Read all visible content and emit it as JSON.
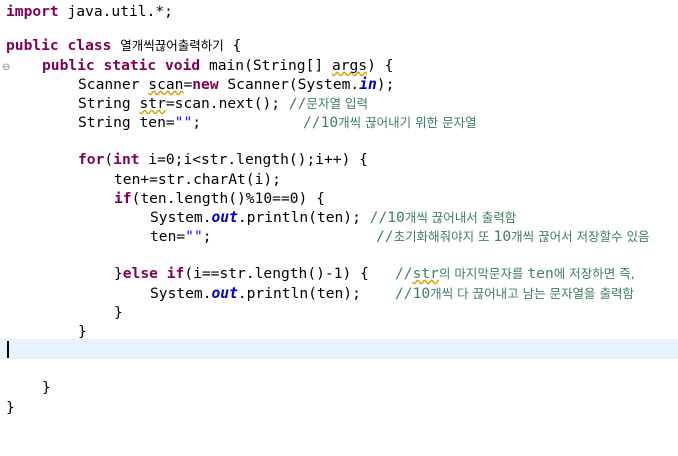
{
  "code": {
    "l1_kw": "import",
    "l1_rest": " java.util.*;",
    "l3_kw": "public class",
    "l3_name": "열개씩끊어출력하기",
    "l3_tail": " {",
    "l4_kw": "public static void",
    "l4_rest": " main(String[] ",
    "l4_args": "args",
    "l4_tail": ") {",
    "l5_a": "Scanner ",
    "l5_var": "scan",
    "l5_eq": "=",
    "l5_new": "new",
    "l5_b": " Scanner(System.",
    "l5_in": "in",
    "l5_c": ");",
    "l6_a": "String ",
    "l6_var": "str",
    "l6_b": "=scan.next(); ",
    "l6_cm_slash": "//",
    "l6_cm": "문자열 입력",
    "l7_a": "String ten=",
    "l7_str": "\"\"",
    "l7_b": ";",
    "l7_cm_slash": "//10",
    "l7_cm": "개씩 끊어내기 위한 문자열",
    "l9_for": "for",
    "l9_a": "(",
    "l9_int": "int",
    "l9_b": " i=0;i<str.length();i++) {",
    "l10": "ten+=str.charAt(i);",
    "l11_if": "if",
    "l11_b": "(ten.length()%10==0) {",
    "l12_a": "System.",
    "l12_out": "out",
    "l12_b": ".println(ten); ",
    "l12_cm_slash": "//10",
    "l12_cm": "개씩 끊어내서 출력함",
    "l13_a": "ten=",
    "l13_str": "\"\"",
    "l13_b": ";",
    "l13_cm_slash": "//",
    "l13_cm1": "초기화해줘야지 또 ",
    "l13_cm_num": "10",
    "l13_cm2": "개씩 끊어서 저장할수 있음",
    "l15_a": "}",
    "l15_else": "else",
    "l15_sp": " ",
    "l15_if": "if",
    "l15_b": "(i==str.length()-1) {",
    "l15_cm_slash": "//",
    "l15_cm_str": "str",
    "l15_cm1": "의 마지막문자를 ",
    "l15_cm_ten": "ten",
    "l15_cm2": "에 저장하면 즉,",
    "l16_a": "System.",
    "l16_out": "out",
    "l16_b": ".println(ten);",
    "l16_cm_slash": "//10",
    "l16_cm": "개씩 다 끊어내고 남는 문자열을 출력함",
    "l17": "}",
    "l18": "}",
    "l21": "}",
    "l22": "}"
  },
  "colors": {
    "keyword": "#7f0055",
    "string": "#2a00ff",
    "field": "#0000c0",
    "comment": "#3f7f5f",
    "current_line": "#e8f2fe"
  },
  "icons": {
    "override_marker": "override-marker-icon"
  }
}
